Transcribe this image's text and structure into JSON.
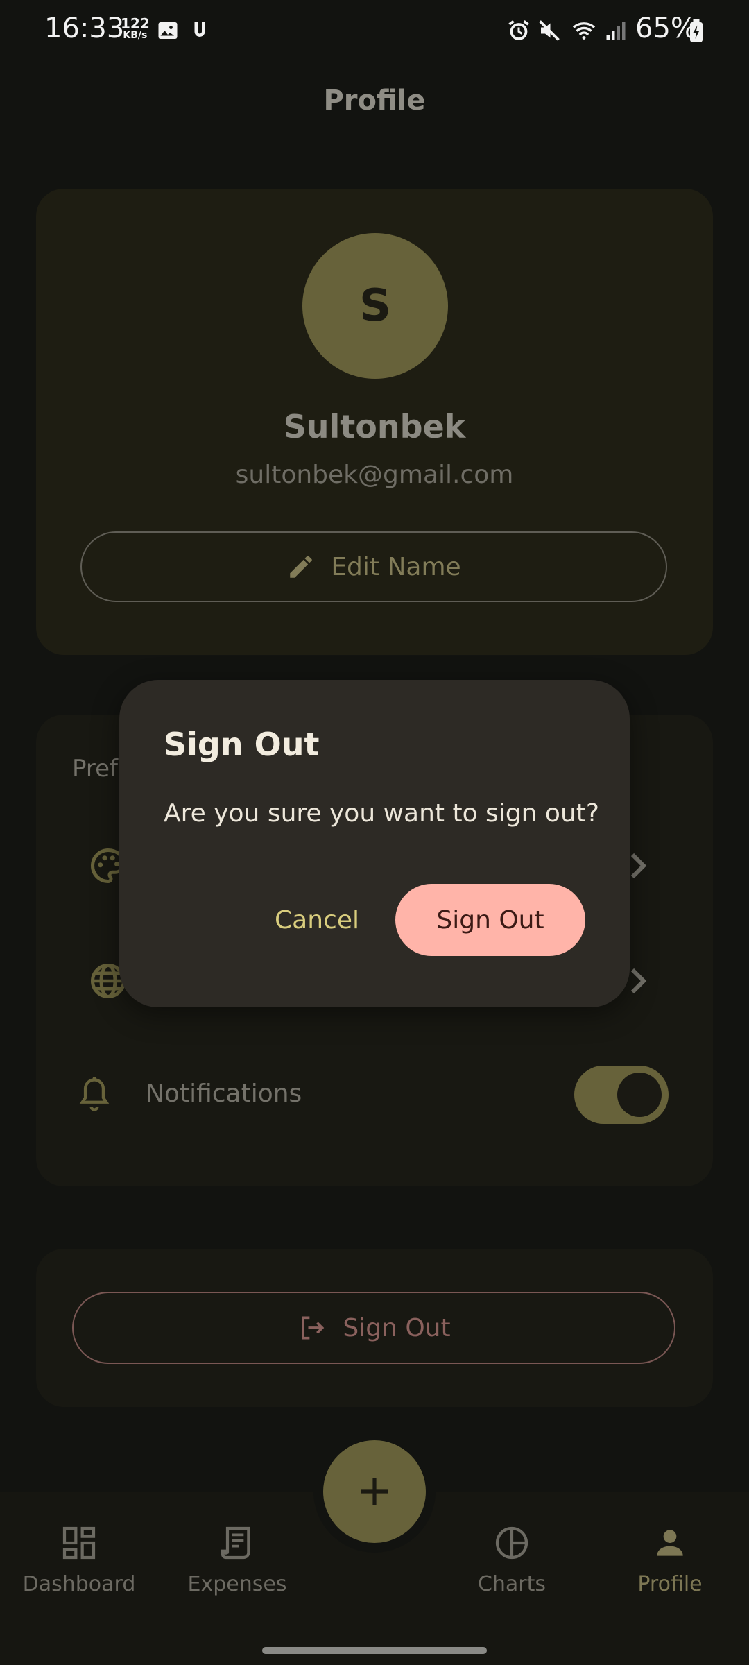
{
  "status_bar": {
    "time": "16:33",
    "net_speed": "122",
    "net_unit": "KB/s",
    "battery": "65%"
  },
  "header": {
    "title": "Profile"
  },
  "profile": {
    "avatar_letter": "S",
    "name": "Sultonbek",
    "email": "sultonbek@gmail.com",
    "edit_label": "Edit Name"
  },
  "preferences": {
    "title": "Pref",
    "items": [
      {
        "icon": "palette-icon"
      },
      {
        "icon": "globe-icon"
      },
      {
        "icon": "bell-icon",
        "label": "Notifications",
        "toggle_on": true
      }
    ]
  },
  "signout_card": {
    "label": "Sign Out"
  },
  "fab": {
    "icon": "plus-icon"
  },
  "nav": {
    "items": [
      {
        "label": "Dashboard",
        "icon": "dashboard-icon",
        "active": false
      },
      {
        "label": "Expenses",
        "icon": "receipt-icon",
        "active": false
      },
      {
        "label": "Charts",
        "icon": "pie-chart-icon",
        "active": false
      },
      {
        "label": "Profile",
        "icon": "person-icon",
        "active": true
      }
    ]
  },
  "dialog": {
    "title": "Sign Out",
    "message": "Are you sure you want to sign out?",
    "cancel_label": "Cancel",
    "confirm_label": "Sign Out"
  },
  "colors": {
    "accent": "#67623a",
    "confirm": "#ffb4a9",
    "cancel_text": "#d9cd7e",
    "dialog_bg": "#2d2a25",
    "background": "#121310"
  }
}
